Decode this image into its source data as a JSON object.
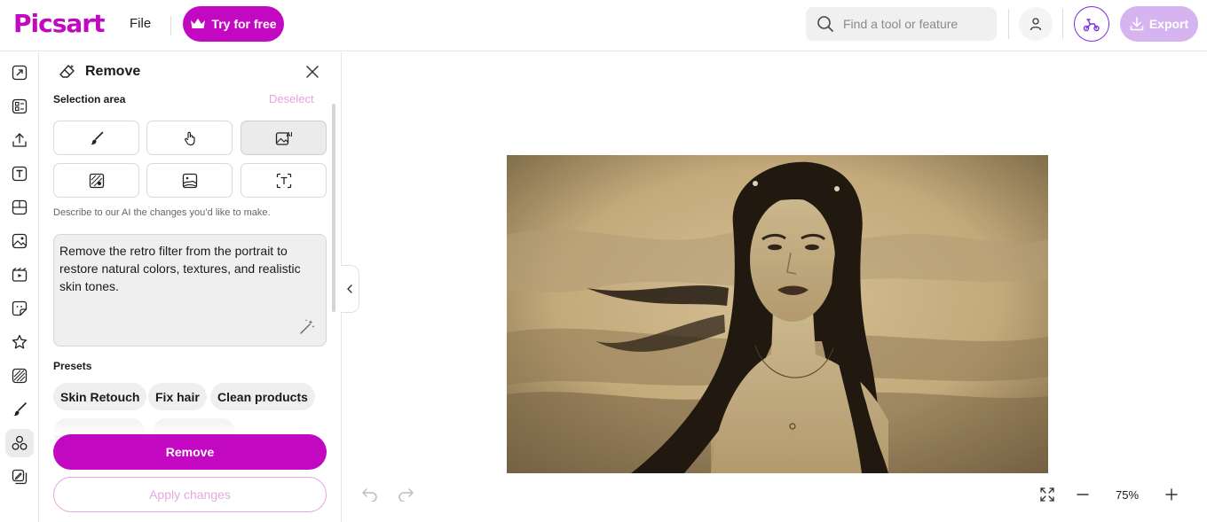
{
  "app": {
    "logo_text": "Picsart",
    "brand_color": "#c209c1"
  },
  "header": {
    "file_label": "File",
    "try_label": "Try for free",
    "search_placeholder": "Find a tool or feature",
    "export_label": "Export"
  },
  "rail": {
    "items": [
      "resize-icon",
      "templates-icon",
      "upload-icon",
      "text-icon",
      "layout-icon",
      "photos-icon",
      "video-icon",
      "stickers-icon",
      "favorites-icon",
      "background-icon",
      "brush-icon",
      "tools-icon",
      "batch-edit-icon"
    ],
    "active_index": 11
  },
  "panel": {
    "title": "Remove",
    "selection_label": "Selection area",
    "deselect_label": "Deselect",
    "tools": [
      "brush-tool",
      "touch-tool",
      "ai-select-tool",
      "object-tool",
      "background-tool",
      "text-tool"
    ],
    "active_tool_index": 2,
    "hint": "Describe to our AI the changes you’d like to make.",
    "prompt": "Remove the retro filter from the portrait to restore natural colors, textures, and realistic skin tones.",
    "presets_label": "Presets",
    "presets": [
      "Skin Retouch",
      "Fix hair",
      "Clean products"
    ],
    "remove_label": "Remove",
    "apply_label": "Apply changes"
  },
  "canvas": {
    "zoom": "75%"
  }
}
